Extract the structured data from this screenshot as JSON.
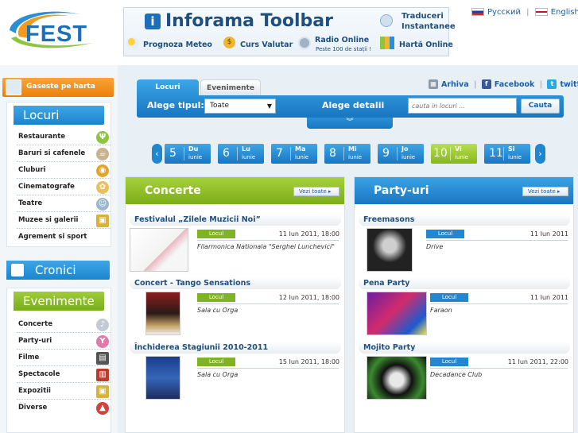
{
  "lang": {
    "ru": "Русский",
    "en": "English"
  },
  "toolbar": {
    "title": "Inforama Toolbar",
    "items": [
      "Prognoza Meteo",
      "Curs Valutar",
      "Radio Online",
      "Hartă Online"
    ],
    "radio_sub": "Peste 100 de stații !",
    "traduceri": "Traduceri",
    "instantanee": "Instantanee"
  },
  "sidebar": {
    "map_button": "Gaseste pe harta",
    "locuri_title": "Locuri",
    "locuri_items": [
      "Restaurante",
      "Baruri si cafenele",
      "Cluburi",
      "Cinematografe",
      "Teatre",
      "Muzee si galerii",
      "Agrement si sport"
    ],
    "cronici_title": "Cronici",
    "evenimente_title": "Evenimente",
    "evenimente_items": [
      "Concerte",
      "Party-uri",
      "Filme",
      "Spectacole",
      "Expozitii",
      "Diverse"
    ]
  },
  "search": {
    "tab_locuri": "Locuri",
    "tab_evenimente": "Evenimente",
    "alege_tipul": "Alege tipul:",
    "select_value": "Toate",
    "alege_detalii": "Alege detalii",
    "placeholder": "cauta in locuri ...",
    "button": "Cauta"
  },
  "social": {
    "arhiva": "Arhiva",
    "facebook": "Facebook",
    "twitter": "twitter"
  },
  "days": [
    {
      "num": "5",
      "name": "Du",
      "month": "iunie"
    },
    {
      "num": "6",
      "name": "Lu",
      "month": "iunie"
    },
    {
      "num": "7",
      "name": "Ma",
      "month": "iunie"
    },
    {
      "num": "8",
      "name": "Mi",
      "month": "iunie"
    },
    {
      "num": "9",
      "name": "Jo",
      "month": "iunie"
    },
    {
      "num": "10",
      "name": "Vi",
      "month": "iunie"
    },
    {
      "num": "11",
      "name": "Si",
      "month": "iunie"
    }
  ],
  "concerte": {
    "title": "Concerte",
    "vezi": "Vezi toate",
    "events": [
      {
        "title": "Festivalul „Zilele Muzicii Noi”",
        "badge": "Locul",
        "date": "11 Iun 2011, 18:00",
        "place": "Filarmonica Nationala \"Serghei Lunchevici\""
      },
      {
        "title": "Concert - Tango Sensations",
        "badge": "Locul",
        "date": "12 Iun 2011, 18:00",
        "place": "Sala cu Orga"
      },
      {
        "title": "Închiderea Stagiunii 2010-2011",
        "badge": "Locul",
        "date": "15 Iun 2011, 18:00",
        "place": "Sala cu Orga"
      }
    ]
  },
  "party": {
    "title": "Party-uri",
    "vezi": "Vezi toate",
    "events": [
      {
        "title": "Freemasons",
        "badge": "Locul",
        "date": "11 Iun 2011",
        "place": "Drive"
      },
      {
        "title": "Pena Party",
        "badge": "Locul",
        "date": "11 Iun 2011",
        "place": "Faraon"
      },
      {
        "title": "Mojito Party",
        "badge": "Locul",
        "date": "11 Iun 2011, 22:00",
        "place": "Decadance Club"
      }
    ]
  },
  "colors": {
    "blue": "#1c84cc",
    "green": "#7cad19",
    "link": "#1c5fa8"
  }
}
